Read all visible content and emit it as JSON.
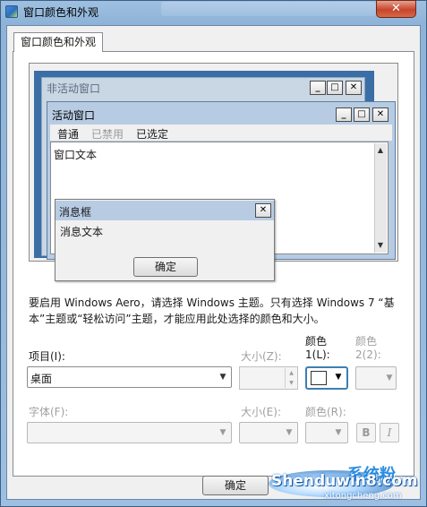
{
  "window": {
    "title": "窗口颜色和外观",
    "close_glyph": "✕"
  },
  "tab": {
    "label": "窗口颜色和外观"
  },
  "preview": {
    "inactive_window_title": "非活动窗口",
    "active_window_title": "活动窗口",
    "menu": [
      "普通",
      "已禁用",
      "已选定"
    ],
    "window_text": "窗口文本",
    "message_box_title": "消息框",
    "message_text": "消息文本",
    "ok_label": "确定",
    "minimize_glyph": "_",
    "maximize_glyph": "□",
    "close_glyph": "✕"
  },
  "description": "要启用 Windows Aero，请选择 Windows 主题。只有选择 Windows 7 “基本”主题或“轻松访问”主题，才能应用此处选择的颜色和大小。",
  "item": {
    "label": "项目(I):",
    "value": "桌面",
    "size_label": "大小(Z):",
    "color1_label_top": "颜色",
    "color1_label_bottom": "1(L):",
    "color2_label_top": "颜色",
    "color2_label_bottom": "2(2):"
  },
  "font": {
    "label": "字体(F):",
    "size_label": "大小(E):",
    "color_label": "颜色(R):",
    "bold_label": "B",
    "italic_label": "I"
  },
  "buttons": {
    "ok": "确定"
  },
  "watermark": {
    "logo": "Shenduwin8.com",
    "chinese": "系统粉",
    "url": "xitongcheng.com"
  },
  "colors": {
    "titlebar": "#9fc0e0",
    "close_button": "#c7452b",
    "desktop": "#3a6ea5",
    "active_title": "#b7cce3",
    "dialog_bg": "#f0f0f0"
  }
}
